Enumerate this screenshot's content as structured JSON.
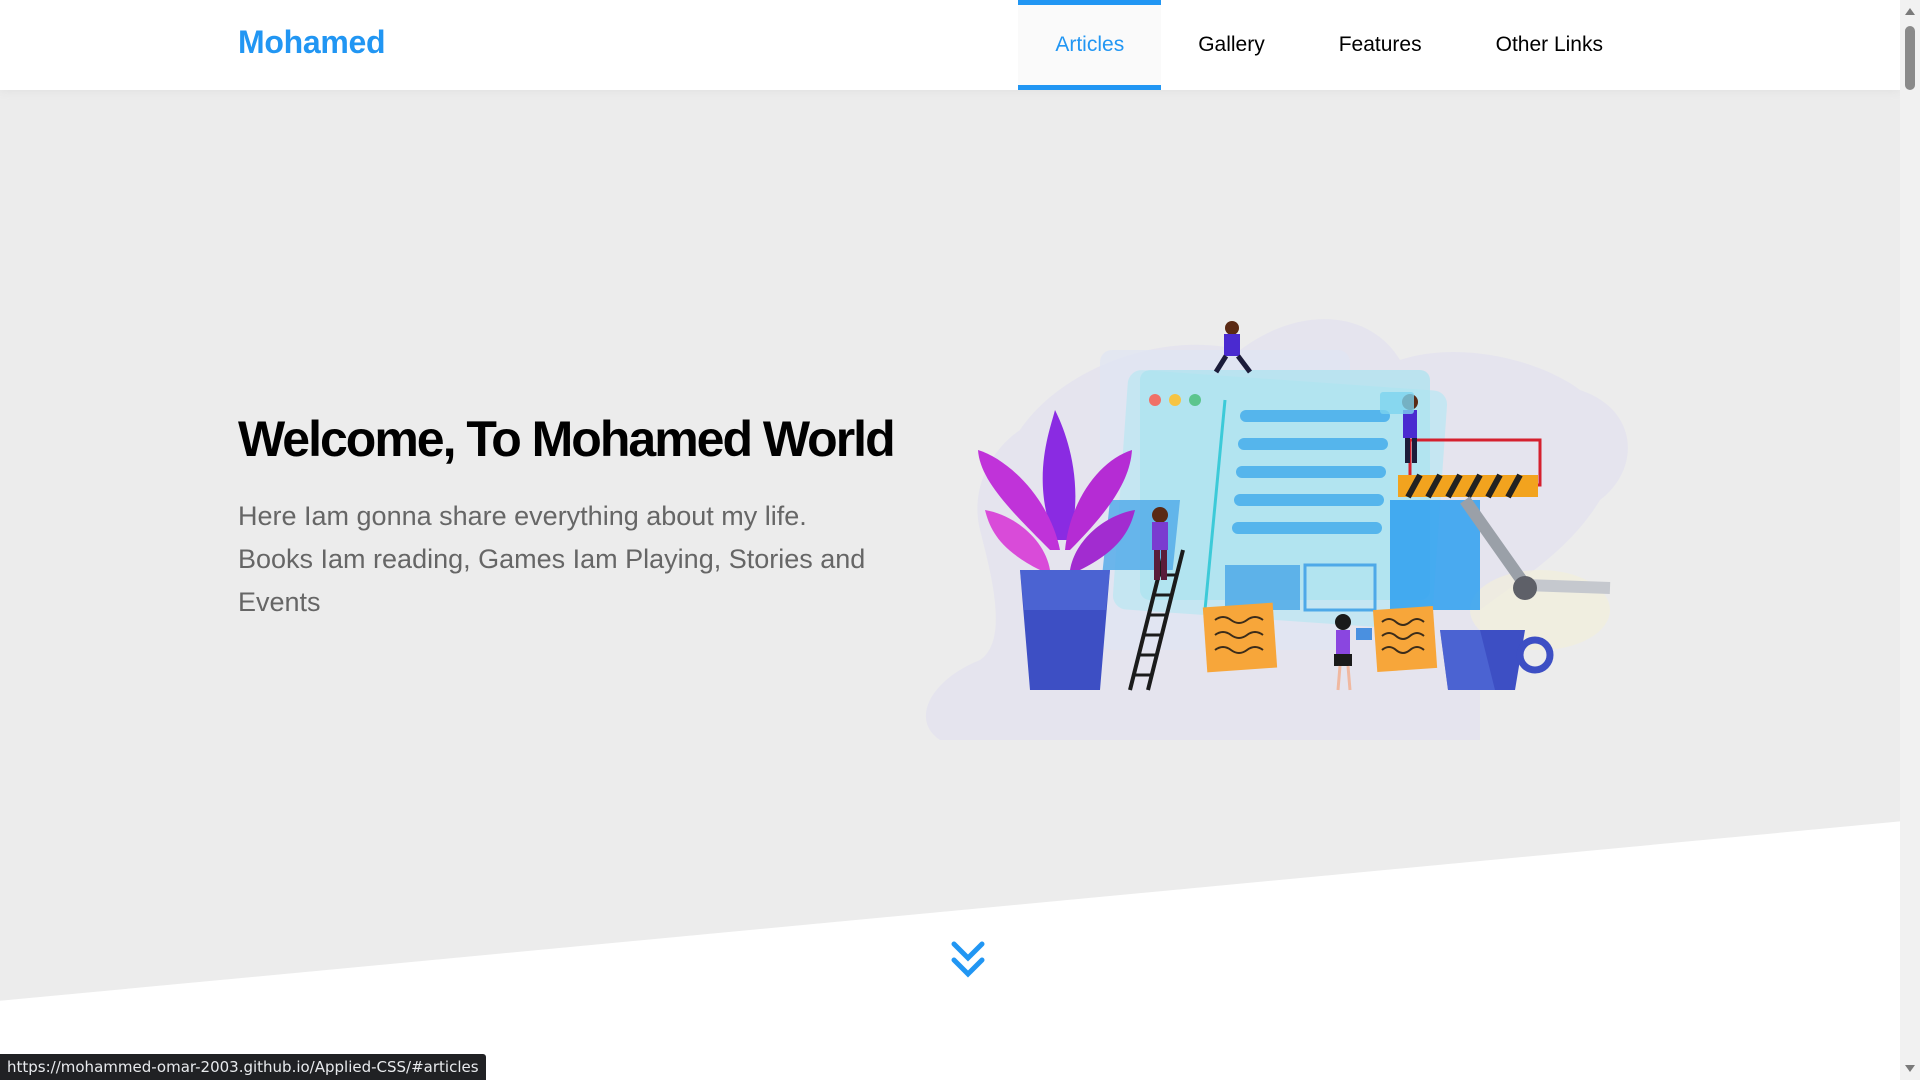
{
  "header": {
    "logo": "Mohamed",
    "nav": [
      {
        "label": "Articles",
        "active": true
      },
      {
        "label": "Gallery",
        "active": false
      },
      {
        "label": "Features",
        "active": false
      },
      {
        "label": "Other Links",
        "active": false
      }
    ]
  },
  "hero": {
    "title": "Welcome, To Mohamed World",
    "text": "Here Iam gonna share everything about my life. Books Iam reading, Games Iam Playing, Stories and Events"
  },
  "status_bar": {
    "url": "https://mohammed-omar-2003.github.io/Applied-CSS/#articles"
  },
  "colors": {
    "accent": "#2196f3",
    "hero_bg": "#ececec"
  },
  "icons": {
    "scroll_down": "double-chevron-down-icon"
  }
}
